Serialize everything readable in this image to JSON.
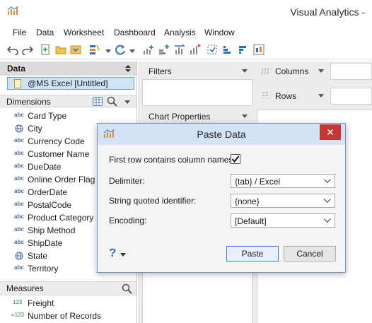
{
  "window": {
    "title": "Visual Analytics -"
  },
  "menu": [
    "File",
    "Data",
    "Worksheet",
    "Dashboard",
    "Analysis",
    "Window"
  ],
  "toolbar_icons": [
    "undo-icon",
    "redo-icon",
    "new-worksheet-icon",
    "open-icon",
    "save-icon",
    "highlight-icon",
    "refresh-icon",
    "add-rows-icon",
    "add-columns-icon",
    "swap-icon",
    "clear-icon",
    "group-icon",
    "sort-ascending-icon",
    "sort-descending-icon",
    "fit-icon"
  ],
  "data_panel": {
    "title": "Data",
    "datasource": "@MS Excel [Untitled]",
    "dimensions_title": "Dimensions",
    "dimensions": [
      {
        "icon": "abc",
        "label": "Card Type"
      },
      {
        "icon": "globe",
        "label": "City"
      },
      {
        "icon": "abc",
        "label": "Currency Code"
      },
      {
        "icon": "abc",
        "label": "Customer Name"
      },
      {
        "icon": "abc",
        "label": "DueDate"
      },
      {
        "icon": "abc",
        "label": "Online Order Flag"
      },
      {
        "icon": "abc",
        "label": "OrderDate"
      },
      {
        "icon": "abc",
        "label": "PostalCode"
      },
      {
        "icon": "abc",
        "label": "Product Category"
      },
      {
        "icon": "abc",
        "label": "Ship Method"
      },
      {
        "icon": "abc",
        "label": "ShipDate"
      },
      {
        "icon": "globe",
        "label": "State"
      },
      {
        "icon": "abc",
        "label": "Territory"
      }
    ],
    "measures_title": "Measures",
    "measures": [
      {
        "icon": "123",
        "label": "Freight"
      },
      {
        "icon": "=123",
        "label": "Number of Records"
      }
    ]
  },
  "shelves": {
    "filters": "Filters",
    "columns": "Columns",
    "rows": "Rows",
    "chart_properties": "Chart Properties"
  },
  "dialog": {
    "title": "Paste Data",
    "first_row_label": "First row contains column names:",
    "first_row_checked": true,
    "delimiter_label": "Delimiter:",
    "delimiter_value": "{tab} / Excel",
    "quoted_label": "String quoted identifier:",
    "quoted_value": "{none}",
    "encoding_label": "Encoding:",
    "encoding_value": "[Default]",
    "paste_label": "Paste",
    "cancel_label": "Cancel",
    "help_glyph": "?",
    "close_glyph": "✕"
  }
}
